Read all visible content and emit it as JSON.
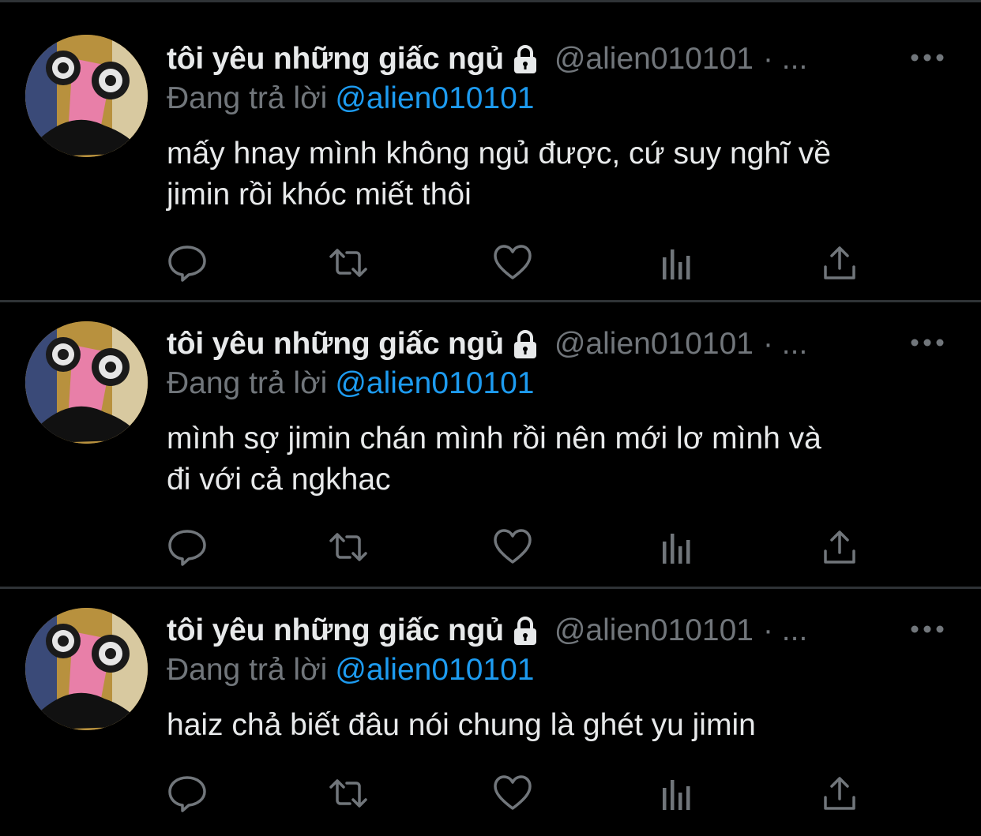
{
  "theme": {
    "background": "#000000",
    "text": "#e7e9ea",
    "muted": "#71767b",
    "accent": "#1d9bf0",
    "divider": "#2f3336"
  },
  "tweets": [
    {
      "display_name": "tôi yêu những giấc ngủ",
      "handle": "@alien010101",
      "sep": "· ...",
      "replying_label": "Đang trả lời",
      "replying_to": "@alien010101",
      "text": "mấy hnay mình không ngủ được, cứ suy nghĩ về\njimin rồi khóc miết thôi",
      "icons": [
        "lock-icon",
        "more-icon",
        "reply-icon",
        "retweet-icon",
        "like-icon",
        "views-icon",
        "share-icon"
      ]
    },
    {
      "display_name": "tôi yêu những giấc ngủ",
      "handle": "@alien010101",
      "sep": "· ...",
      "replying_label": "Đang trả lời",
      "replying_to": "@alien010101",
      "text": "mình sợ jimin chán mình rồi nên mới lơ mình và\nđi với cả ngkhac",
      "icons": [
        "lock-icon",
        "more-icon",
        "reply-icon",
        "retweet-icon",
        "like-icon",
        "views-icon",
        "share-icon"
      ]
    },
    {
      "display_name": "tôi yêu những giấc ngủ",
      "handle": "@alien010101",
      "sep": "· ...",
      "replying_label": "Đang trả lời",
      "replying_to": "@alien010101",
      "text": "haiz chả biết đâu nói chung là ghét yu jimin",
      "icons": [
        "lock-icon",
        "more-icon",
        "reply-icon",
        "retweet-icon",
        "like-icon",
        "views-icon",
        "share-icon"
      ]
    }
  ]
}
